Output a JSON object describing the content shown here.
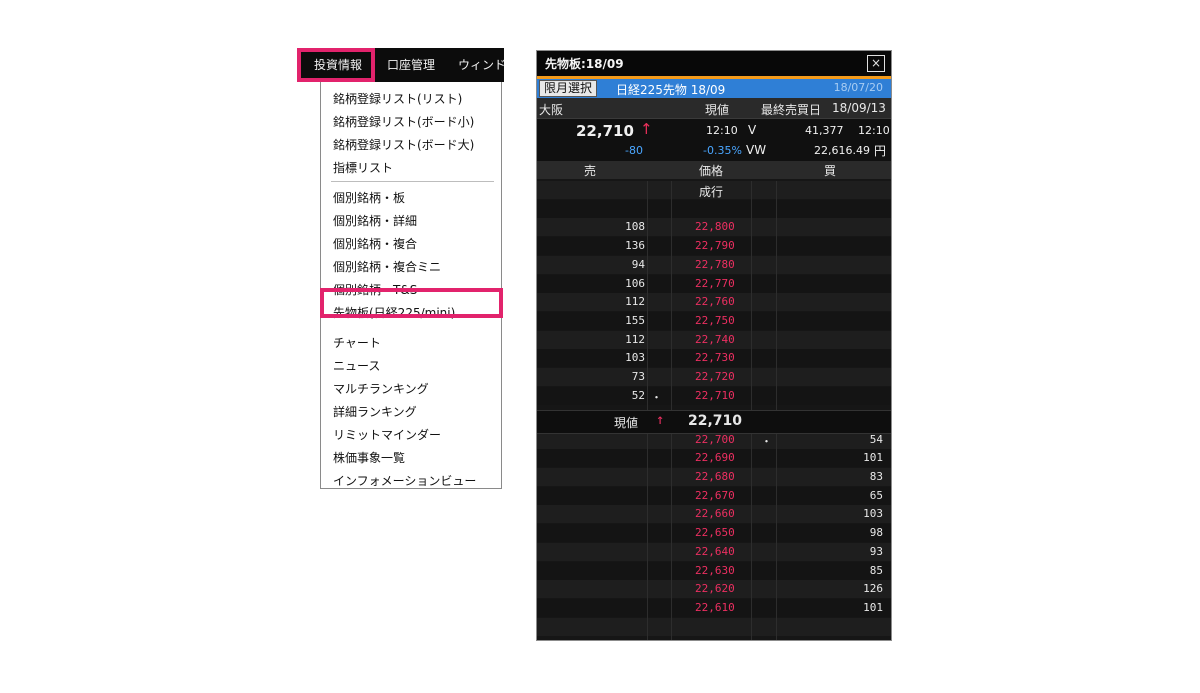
{
  "menubar": {
    "items": [
      "投資情報",
      "口座管理",
      "ウィンド"
    ],
    "highlight_color": "#e2236c"
  },
  "dropdown": {
    "group1": [
      "銘柄登録リスト(リスト)",
      "銘柄登録リスト(ボード小)",
      "銘柄登録リスト(ボード大)",
      "指標リスト"
    ],
    "group2": [
      "個別銘柄・板",
      "個別銘柄・詳細",
      "個別銘柄・複合",
      "個別銘柄・複合ミニ",
      "個別銘柄・T&S",
      "先物板(日経225/mini)",
      "チャート",
      "ニュース",
      "マルチランキング",
      "詳細ランキング",
      "リミットマインダー",
      "株価事象一覧",
      "インフォメーションビュー"
    ]
  },
  "board": {
    "title": "先物板:18/09",
    "close_label": "×",
    "month_select_label": "限月選択",
    "contract_name": "日経225先物 18/09",
    "contract_date": "18/07/20",
    "info": {
      "market": "大阪",
      "current_label": "現値",
      "last_trade_label": "最終売買日",
      "last_trade_date": "18/09/13",
      "last_price": "22,710",
      "last_arrow": "↑",
      "time": "12:10",
      "v_label": "V",
      "volume": "41,377",
      "volume_time": "12:10",
      "change": "-80",
      "change_pct": "-0.35%",
      "vw_label": "VW",
      "vwap": "22,616.49",
      "yen": "円"
    },
    "columns": {
      "sell": "売",
      "price": "価格",
      "buy": "買"
    },
    "market_order_label": "成行",
    "asks": [
      {
        "qty": "108",
        "price": "22,800",
        "dot": ""
      },
      {
        "qty": "136",
        "price": "22,790",
        "dot": ""
      },
      {
        "qty": "94",
        "price": "22,780",
        "dot": ""
      },
      {
        "qty": "106",
        "price": "22,770",
        "dot": ""
      },
      {
        "qty": "112",
        "price": "22,760",
        "dot": ""
      },
      {
        "qty": "155",
        "price": "22,750",
        "dot": ""
      },
      {
        "qty": "112",
        "price": "22,740",
        "dot": ""
      },
      {
        "qty": "103",
        "price": "22,730",
        "dot": ""
      },
      {
        "qty": "73",
        "price": "22,720",
        "dot": ""
      },
      {
        "qty": "52",
        "price": "22,710",
        "dot": "・"
      }
    ],
    "current": {
      "label": "現値",
      "arrow": "↑",
      "price": "22,710"
    },
    "bids": [
      {
        "price": "22,700",
        "qty": "54",
        "dot": "・"
      },
      {
        "price": "22,690",
        "qty": "101",
        "dot": ""
      },
      {
        "price": "22,680",
        "qty": "83",
        "dot": ""
      },
      {
        "price": "22,670",
        "qty": "65",
        "dot": ""
      },
      {
        "price": "22,660",
        "qty": "103",
        "dot": ""
      },
      {
        "price": "22,650",
        "qty": "98",
        "dot": ""
      },
      {
        "price": "22,640",
        "qty": "93",
        "dot": ""
      },
      {
        "price": "22,630",
        "qty": "85",
        "dot": ""
      },
      {
        "price": "22,620",
        "qty": "126",
        "dot": ""
      },
      {
        "price": "22,610",
        "qty": "101",
        "dot": ""
      }
    ],
    "colors": {
      "price_red": "#ec2f61",
      "change_blue": "#4aa6ff",
      "header_blue": "#2f7fd6",
      "accent_orange": "#f39a1a"
    }
  }
}
